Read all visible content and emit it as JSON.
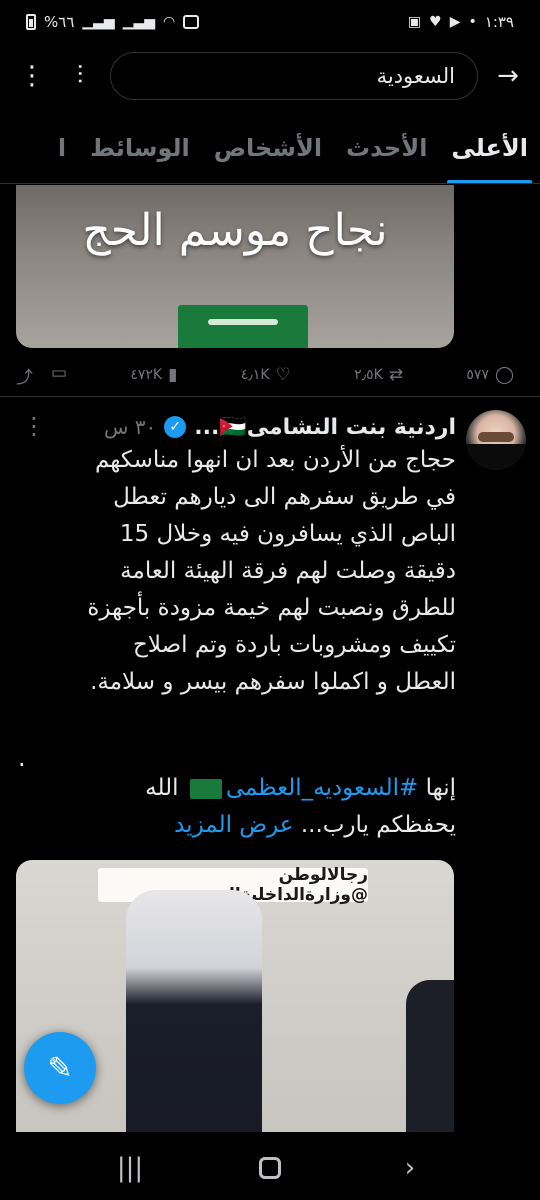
{
  "status_bar": {
    "time": "١:٣٩",
    "battery": "%٦٦"
  },
  "search": {
    "query": "السعودية"
  },
  "tabs": [
    {
      "label": "الأعلى",
      "active": true
    },
    {
      "label": "الأحدث",
      "active": false
    },
    {
      "label": "الأشخاص",
      "active": false
    },
    {
      "label": "الوسائط",
      "active": false
    },
    {
      "label": "ا",
      "active": false
    }
  ],
  "prev_tweet": {
    "media_caption": "نجاح موسم الحج",
    "actions": {
      "replies": "٥٧٧",
      "reposts": "٢٫٥K",
      "likes": "٤٫١K",
      "views": "٤٧٢K"
    }
  },
  "tweet": {
    "author": "اردنية بنت النشامى🇯🇴...",
    "time": "٣٠ س",
    "body": "حجاج من الأردن بعد ان انهوا مناسكهم\nفي طريق سفرهم الى ديارهم تعطل\nالباص الذي يسافرون فيه وخلال 15\nدقيقة وصلت لهم فرقة الهيئة العامة\nللطرق ونصبت لهم خيمة مزودة بأجهزة\nتكييف ومشروبات باردة وتم اصلاح\nالعطل و اكملوا سفرهم بيسر و سلامة.",
    "dot": ".",
    "line2_prefix": "إنها ",
    "hashtag": "#السعوديه_العظمى",
    "line2_suffix": " الله",
    "line3": "يحفظكم يارب... ",
    "show_more": "عرض المزيد",
    "media_banner": "رجالالوطن @وزارةالداخليةالسعودية"
  },
  "colors": {
    "accent": "#1d9bf0",
    "background": "#000000",
    "text": "#e7e9ea",
    "muted": "#71767b"
  }
}
